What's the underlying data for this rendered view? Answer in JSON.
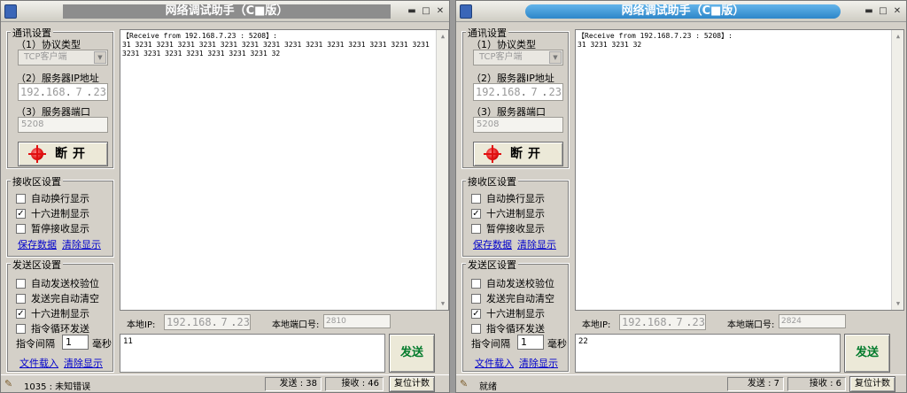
{
  "windows": [
    {
      "title": "网络调试助手（C■版）",
      "settings": {
        "group_label": "通讯设置",
        "protocol_label": "（1）协议类型",
        "protocol_value": "TCP客户端",
        "server_ip_label": "（2）服务器IP地址",
        "server_ip": [
          "192",
          "168",
          "7",
          "23"
        ],
        "server_port_label": "（3）服务器端口",
        "server_port": "5208",
        "disconnect_label": "断开"
      },
      "receive": {
        "group_label": "接收区设置",
        "options": [
          {
            "label": "自动换行显示",
            "checked": false
          },
          {
            "label": "十六进制显示",
            "checked": true
          },
          {
            "label": "暂停接收显示",
            "checked": false
          }
        ],
        "save_link": "保存数据",
        "clear_link": "清除显示"
      },
      "send": {
        "group_label": "发送区设置",
        "options": [
          {
            "label": "自动发送校验位",
            "checked": false
          },
          {
            "label": "发送完自动清空",
            "checked": false
          },
          {
            "label": "十六进制显示",
            "checked": true
          },
          {
            "label": "指令循环发送",
            "checked": false
          }
        ],
        "interval_label": "指令间隔",
        "interval_value": "1",
        "interval_unit": "毫秒",
        "load_link": "文件载入",
        "clear_link": "清除显示"
      },
      "recv_header": "【Receive from 192.168.7.23 : 5208】:",
      "recv_data": "31 3231 3231 3231 3231 3231 3231 3231 3231 3231 3231 3231 3231 3231 3231 3231 3231 3231 3231 3231 3231 3231 32",
      "local_ip_label": "本地IP:",
      "local_ip": [
        "192",
        "168",
        "7",
        "23"
      ],
      "local_port_label": "本地端口号:",
      "local_port": "2810",
      "send_text": "11",
      "send_button": "发送",
      "status_msg": "1035 : 未知错误",
      "sent_label": "发送 : 38",
      "recv_label": "接收 : 46",
      "reset_label": "复位计数"
    },
    {
      "title": "网络调试助手（C■版）",
      "settings": {
        "group_label": "通讯设置",
        "protocol_label": "（1）协议类型",
        "protocol_value": "TCP客户端",
        "server_ip_label": "（2）服务器IP地址",
        "server_ip": [
          "192",
          "168",
          "7",
          "23"
        ],
        "server_port_label": "（3）服务器端口",
        "server_port": "5208",
        "disconnect_label": "断开"
      },
      "receive": {
        "group_label": "接收区设置",
        "options": [
          {
            "label": "自动换行显示",
            "checked": false
          },
          {
            "label": "十六进制显示",
            "checked": true
          },
          {
            "label": "暂停接收显示",
            "checked": false
          }
        ],
        "save_link": "保存数据",
        "clear_link": "清除显示"
      },
      "send": {
        "group_label": "发送区设置",
        "options": [
          {
            "label": "自动发送校验位",
            "checked": false
          },
          {
            "label": "发送完自动清空",
            "checked": false
          },
          {
            "label": "十六进制显示",
            "checked": true
          },
          {
            "label": "指令循环发送",
            "checked": false
          }
        ],
        "interval_label": "指令间隔",
        "interval_value": "1",
        "interval_unit": "毫秒",
        "load_link": "文件载入",
        "clear_link": "清除显示"
      },
      "recv_header": "【Receive from 192.168.7.23 : 5208】:",
      "recv_data": "31 3231 3231 32",
      "local_ip_label": "本地IP:",
      "local_ip": [
        "192",
        "168",
        "7",
        "23"
      ],
      "local_port_label": "本地端口号:",
      "local_port": "2824",
      "send_text": "22",
      "send_button": "发送",
      "status_msg": "就绪",
      "sent_label": "发送 : 7",
      "recv_label": "接收 : 6",
      "reset_label": "复位计数"
    }
  ]
}
